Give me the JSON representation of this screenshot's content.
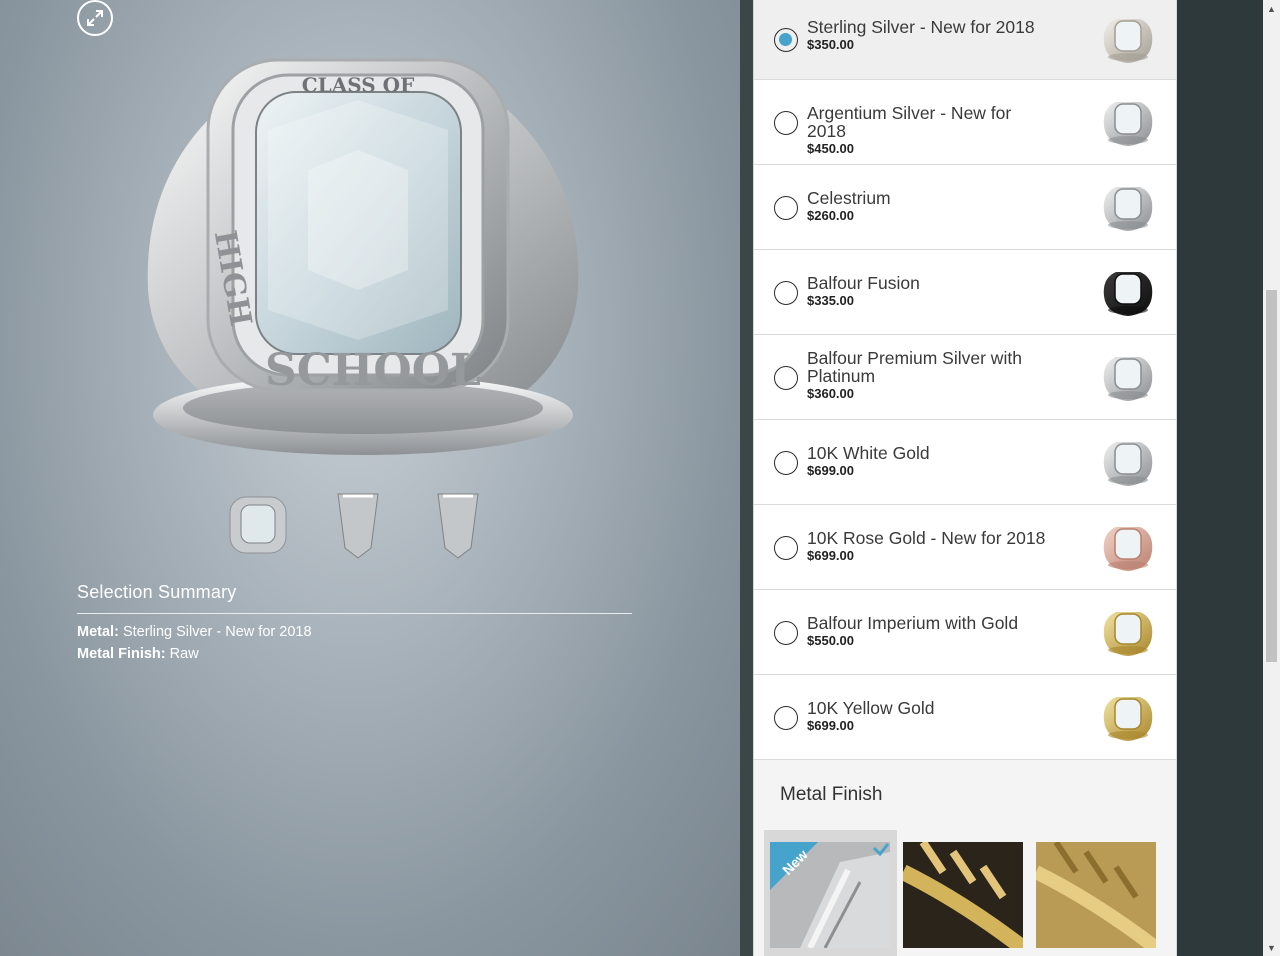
{
  "summary": {
    "title": "Selection Summary",
    "metal_label": "Metal:",
    "metal_value": "Sterling Silver - New for 2018",
    "finish_label": "Metal Finish:",
    "finish_value": "Raw"
  },
  "ring": {
    "top_text": "CLASS OF",
    "side_text_left": "HIGH",
    "side_text_bottom": "SCHOOL"
  },
  "metals": [
    {
      "name": "Sterling Silver - New for 2018",
      "price": "$350.00",
      "selected": true,
      "tone": "silver-warm"
    },
    {
      "name": "Argentium Silver - New for 2018",
      "price": "$450.00",
      "selected": false,
      "tone": "silver"
    },
    {
      "name": "Celestrium",
      "price": "$260.00",
      "selected": false,
      "tone": "silver"
    },
    {
      "name": "Balfour Fusion",
      "price": "$335.00",
      "selected": false,
      "tone": "black"
    },
    {
      "name": "Balfour Premium Silver with Platinum",
      "price": "$360.00",
      "selected": false,
      "tone": "silver"
    },
    {
      "name": "10K White Gold",
      "price": "$699.00",
      "selected": false,
      "tone": "silver"
    },
    {
      "name": "10K Rose Gold - New for 2018",
      "price": "$699.00",
      "selected": false,
      "tone": "rose"
    },
    {
      "name": "Balfour Imperium with Gold",
      "price": "$550.00",
      "selected": false,
      "tone": "gold"
    },
    {
      "name": "10K Yellow Gold",
      "price": "$699.00",
      "selected": false,
      "tone": "gold"
    }
  ],
  "finish": {
    "title": "Metal Finish",
    "new_badge": "New"
  },
  "colors": {
    "accent": "#45a3cc",
    "selected_bg": "#efefef",
    "gold": "#c9a53a",
    "rose": "#d9a08e",
    "black": "#1e1e1e"
  }
}
